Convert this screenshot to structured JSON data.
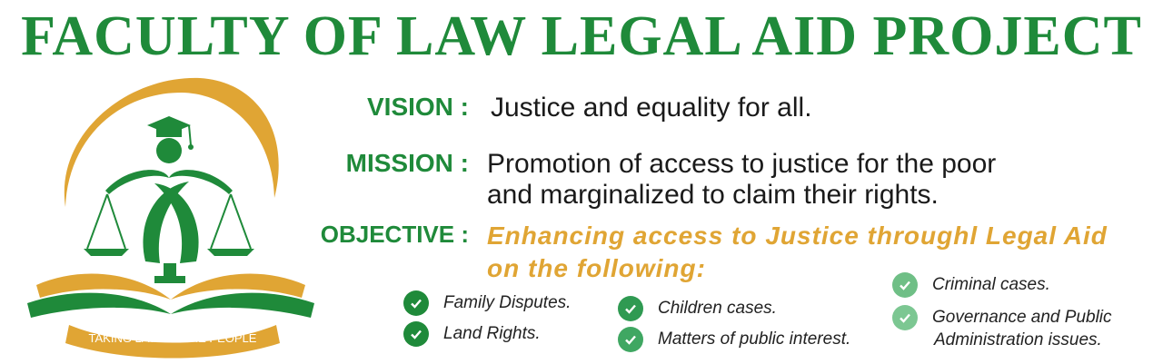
{
  "title": "FACULTY OF LAW LEGAL AID PROJECT",
  "logo": {
    "ribbon_text": "TAKING LAW TO THE PEOPLE"
  },
  "vision": {
    "label": "VISION :",
    "text": "Justice and equality for all."
  },
  "mission": {
    "label": "MISSION :",
    "text_line1": "Promotion of access to justice for the poor",
    "text_line2": "and marginalized to claim their rights."
  },
  "objective": {
    "label": "OBJECTIVE :",
    "text_line1": "Enhancing access to Justice throughl Legal Aid",
    "text_line2": "on the following:"
  },
  "items": [
    {
      "label": "Family Disputes."
    },
    {
      "label": "Land Rights."
    },
    {
      "label": "Children cases."
    },
    {
      "label": "Matters of public interest."
    },
    {
      "label": "Criminal cases."
    },
    {
      "label": "Governance and Public"
    },
    {
      "label": "Administration issues."
    }
  ],
  "colors": {
    "green": "#1f8a3a",
    "light_green": "#6fbf86",
    "gold": "#e0a534",
    "text": "#1a1a1a"
  },
  "icons": [
    "check-circle-icon",
    "scales-of-justice-icon",
    "graduation-cap-icon",
    "open-book-icon"
  ]
}
